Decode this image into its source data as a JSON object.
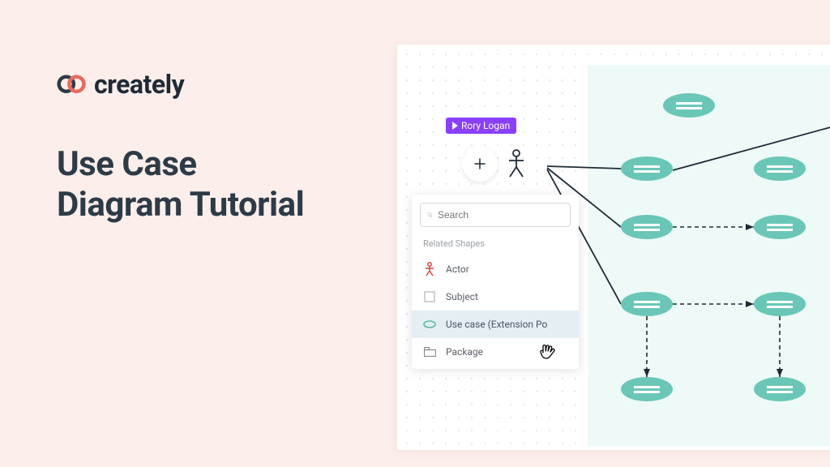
{
  "brand": "creately",
  "title_line1": "Use Case",
  "title_line2": "Diagram Tutorial",
  "user_label": "Rory Logan",
  "panel": {
    "search_placeholder": "Search",
    "heading": "Related Shapes",
    "items": {
      "actor": "Actor",
      "subject": "Subject",
      "usecase_ext": "Use case (Extension Po",
      "package": "Package"
    }
  }
}
